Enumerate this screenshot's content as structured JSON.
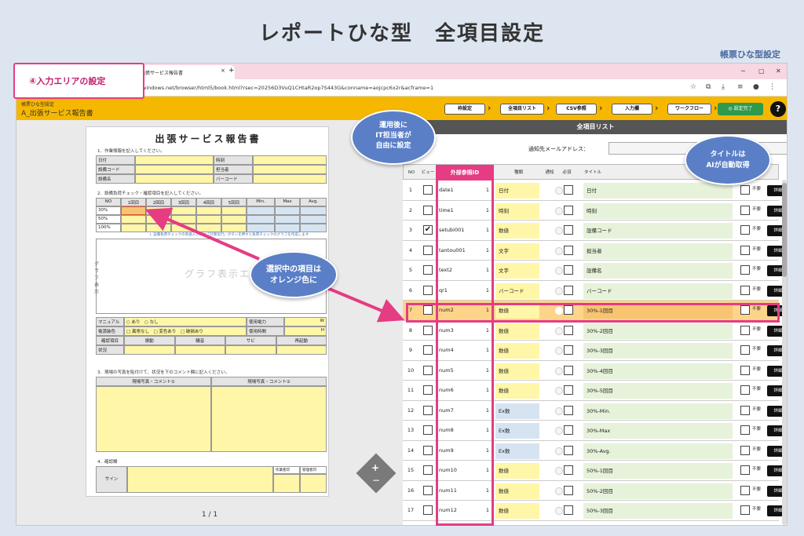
{
  "slide": {
    "title": "レポートひな型　全項目設定",
    "brand": "帳票ひな型設定"
  },
  "browser": {
    "tab_title": "出張サービス報告書",
    "tab_close": "×",
    "tab_new": "+",
    "url": "windows.net/browser/html5/book.html?rsec=20256D3VuQ1CHtaR2op7S443G&conname=aojcpc6x2r&acframe=1",
    "win_min": "─",
    "win_max": "▢",
    "win_close": "✕",
    "icons": [
      "star-icon",
      "extension-icon",
      "download-icon",
      "reading-list-icon",
      "profile-icon",
      "menu-icon"
    ],
    "icon_glyphs": [
      "☆",
      "⧉",
      "⤓",
      "≡",
      "●",
      "⋮"
    ]
  },
  "app": {
    "crumb": "帳票ひな型設定",
    "name": "A_出張サービス報告書",
    "steps": [
      {
        "label": "枠設定",
        "dark": true
      },
      {
        "label": "全項目リスト",
        "dark": false
      },
      {
        "label": "CSV参照",
        "dark": true
      },
      {
        "label": "入力欄",
        "dark": true
      },
      {
        "label": "ワークフロー",
        "dark": true
      }
    ],
    "done": "◎ 設定完了",
    "help": "?"
  },
  "doc": {
    "title": "出張サービス報告書",
    "sec1": "1．作業情報を記入してください。",
    "info_labels": [
      "日付",
      "設備コード",
      "設備名"
    ],
    "info_labels2": [
      "時刻",
      "担当者",
      "バーコード"
    ],
    "sec2": "2．設備負荷チェック・確認項目を記入してください。",
    "grid_headers": [
      "NO",
      "1回目",
      "2回目",
      "3回目",
      "4回目",
      "5回目",
      "Min.",
      "Max",
      "Avg."
    ],
    "grid_rows": [
      "30%",
      "50%",
      "100%"
    ],
    "graph_note": "↓ 設備負荷チェックの各値入力後に「計算実行」ボタンを押すと負荷チェックのグラフを作成します",
    "graph_label": "グラフ表示エ",
    "graph_side": "グラフ表示",
    "check_rows": [
      {
        "label": "マニュアル",
        "opts": "○ あり　○ なし",
        "right": "使用電力",
        "unit": "W"
      },
      {
        "label": "電源装色",
        "opts": "□ 異常なし　□ 変色あり　□ 破損あり",
        "right": "使用時間",
        "unit": "H"
      }
    ],
    "check_headers": [
      "確認項目",
      "振動",
      "騒音",
      "サビ",
      "再起動"
    ],
    "status_label": "状況",
    "sec3": "3．現場の写真を貼付けて、状況を下のコメント欄に記入ください。",
    "photo_headers": [
      "現場写真・コメント①",
      "現場写真・コメント②"
    ],
    "sec4": "4．確認欄",
    "sign_label": "サイン",
    "sign_headers": [
      "作業者印",
      "管理者印"
    ],
    "pager": "1 / 1",
    "zoom_plus": "+",
    "zoom_minus": "−"
  },
  "list": {
    "title": "全項目リスト",
    "mail_label": "通知先メールアドレス：",
    "headers": [
      "NO",
      "ビュー",
      "外部参照ID",
      "",
      "種類",
      "通知",
      "必須",
      "タイトル",
      "",
      ""
    ],
    "unneeded": "不要",
    "detail": "詳細",
    "rows": [
      {
        "no": "1",
        "view": false,
        "id": "date1",
        "n": "1",
        "type": "日付",
        "title": "日付",
        "sel": false
      },
      {
        "no": "2",
        "view": false,
        "id": "time1",
        "n": "1",
        "type": "時刻",
        "title": "時刻",
        "sel": false
      },
      {
        "no": "3",
        "view": true,
        "id": "setubi001",
        "n": "1",
        "type": "数値",
        "title": "設備コード",
        "sel": false
      },
      {
        "no": "4",
        "view": false,
        "id": "tantou001",
        "n": "1",
        "type": "文字",
        "title": "担当者",
        "sel": false
      },
      {
        "no": "5",
        "view": false,
        "id": "text2",
        "n": "1",
        "type": "文字",
        "title": "設備名",
        "sel": false
      },
      {
        "no": "6",
        "view": false,
        "id": "qr1",
        "n": "1",
        "type": "バーコード",
        "title": "バーコード",
        "sel": false
      },
      {
        "no": "7",
        "view": false,
        "id": "num2",
        "n": "1",
        "type": "数値",
        "title": "30%-1回目",
        "sel": true
      },
      {
        "no": "8",
        "view": false,
        "id": "num3",
        "n": "1",
        "type": "数値",
        "title": "30%-2回目",
        "sel": false
      },
      {
        "no": "9",
        "view": false,
        "id": "num4",
        "n": "1",
        "type": "数値",
        "title": "30%-3回目",
        "sel": false
      },
      {
        "no": "10",
        "view": false,
        "id": "num5",
        "n": "1",
        "type": "数値",
        "title": "30%-4回目",
        "sel": false
      },
      {
        "no": "11",
        "view": false,
        "id": "num6",
        "n": "1",
        "type": "数値",
        "title": "30%-5回目",
        "sel": false
      },
      {
        "no": "12",
        "view": false,
        "id": "num7",
        "n": "1",
        "type": "Ex数",
        "title": "30%-Min.",
        "sel": false
      },
      {
        "no": "13",
        "view": false,
        "id": "num8",
        "n": "1",
        "type": "Ex数",
        "title": "30%-Max",
        "sel": false
      },
      {
        "no": "14",
        "view": false,
        "id": "num9",
        "n": "1",
        "type": "Ex数",
        "title": "30%-Avg.",
        "sel": false
      },
      {
        "no": "15",
        "view": false,
        "id": "num10",
        "n": "1",
        "type": "数値",
        "title": "50%-1回目",
        "sel": false
      },
      {
        "no": "16",
        "view": false,
        "id": "num11",
        "n": "1",
        "type": "数値",
        "title": "50%-2回目",
        "sel": false
      },
      {
        "no": "17",
        "view": false,
        "id": "num12",
        "n": "1",
        "type": "数値",
        "title": "50%-3回目",
        "sel": false
      }
    ]
  },
  "annotations": {
    "tag": "④入力エリアの設定",
    "bubble_ops": [
      "運用後に",
      "IT担当者が",
      "自由に設定"
    ],
    "bubble_title": [
      "タイトルは",
      "AIが自動取得"
    ],
    "bubble_sel": [
      "選択中の項目は",
      "オレンジ色に"
    ],
    "ext_id": "外部参照ID"
  },
  "colors": {
    "accent": "#f6b700",
    "highlight": "#e53c84",
    "selected": "#fdd48a",
    "bubble": "#5b7fc7"
  }
}
